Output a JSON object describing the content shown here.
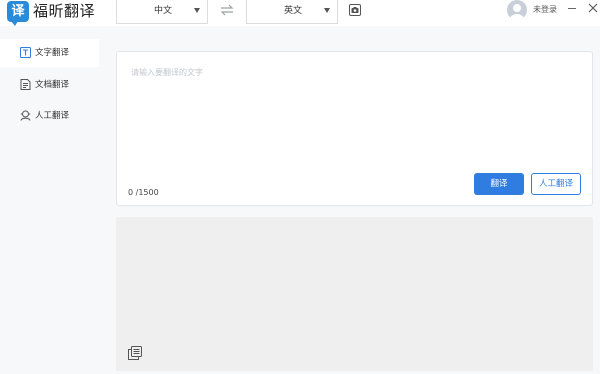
{
  "app": {
    "logo_glyph": "译",
    "title": "福昕翻译"
  },
  "lang": {
    "source": "中文",
    "target": "英文"
  },
  "user": {
    "login_label": "未登录"
  },
  "sidebar": {
    "items": [
      {
        "label": "文字翻译",
        "icon": "text-icon",
        "active": true
      },
      {
        "label": "文档翻译",
        "icon": "document-icon",
        "active": false
      },
      {
        "label": "人工翻译",
        "icon": "human-icon",
        "active": false
      }
    ]
  },
  "input": {
    "placeholder": "请输入要翻译的文字",
    "count": "0 /1500"
  },
  "buttons": {
    "translate": "翻译",
    "human": "人工翻译"
  },
  "colors": {
    "accent": "#2f7de1",
    "logo": "#2a8bd9",
    "output_bg": "#efefef"
  }
}
